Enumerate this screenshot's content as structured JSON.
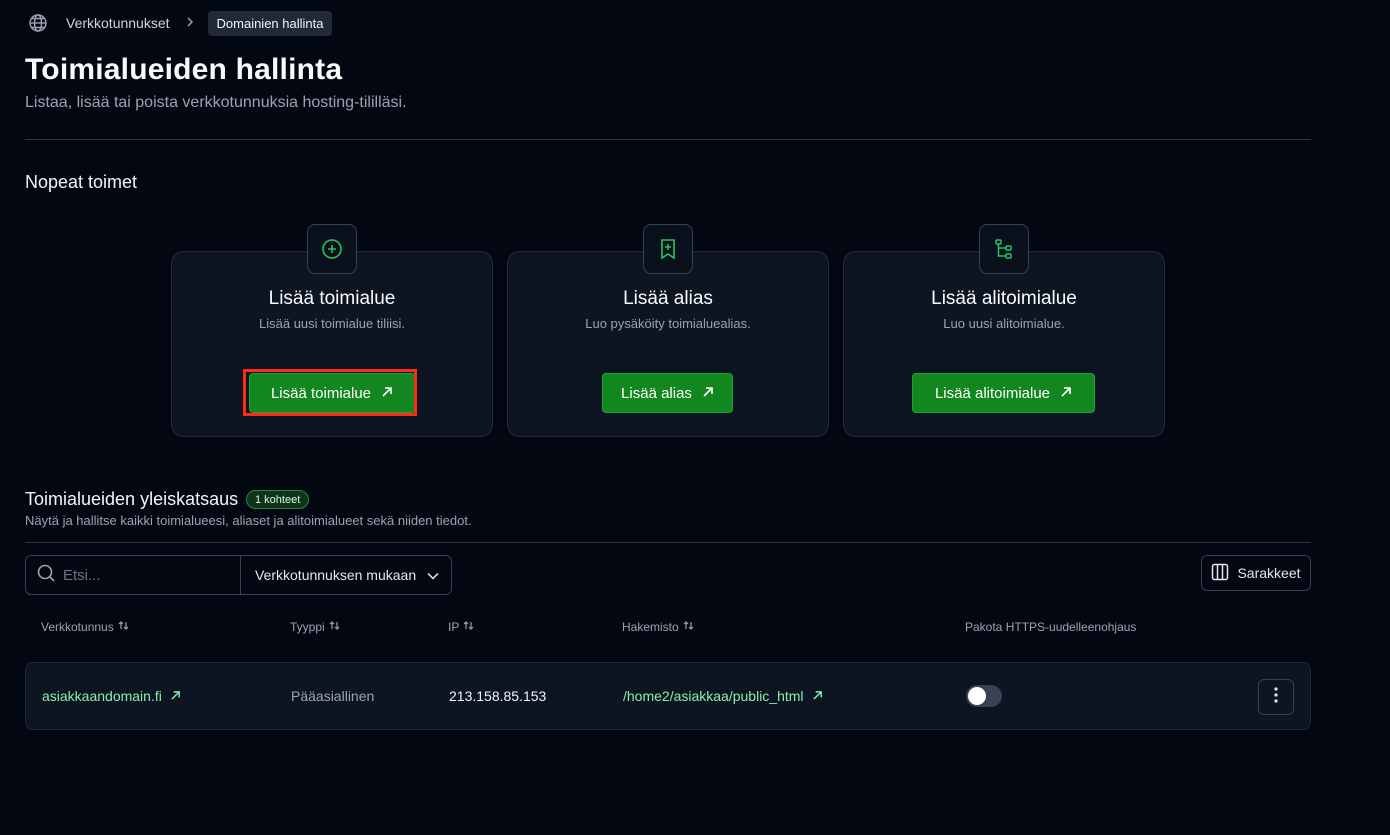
{
  "breadcrumb": {
    "icon": "globe-icon",
    "parent": "Verkkotunnukset",
    "current": "Domainien hallinta"
  },
  "page": {
    "title": "Toimialueiden hallinta",
    "subtitle": "Listaa, lisää tai poista verkkotunnuksia hosting-tililläsi."
  },
  "quick_actions": {
    "title": "Nopeat toimet",
    "cards": [
      {
        "icon": "plus-circle-icon",
        "title": "Lisää toimialue",
        "description": "Lisää uusi toimialue tiliisi.",
        "button": "Lisää toimialue",
        "highlighted": true
      },
      {
        "icon": "bookmark-plus-icon",
        "title": "Lisää alias",
        "description": "Luo pysäköity toimialuealias.",
        "button": "Lisää alias"
      },
      {
        "icon": "folder-tree-icon",
        "title": "Lisää alitoimialue",
        "description": "Luo uusi alitoimialue.",
        "button": "Lisää alitoimialue"
      }
    ]
  },
  "overview": {
    "title": "Toimialueiden yleiskatsaus",
    "badge": "1 kohteet",
    "description": "Näytä ja hallitse kaikki toimialueesi, aliaset ja alitoimialueet sekä niiden tiedot.",
    "search_placeholder": "Etsi...",
    "filter_value": "Verkkotunnuksen mukaan",
    "columns_button": "Sarakkeet",
    "columns": [
      "Verkkotunnus",
      "Tyyppi",
      "IP",
      "Hakemisto",
      "Pakota HTTPS-uudelleenohjaus"
    ],
    "rows": [
      {
        "domain": "asiakkaandomain.fi",
        "type": "Pääasiallinen",
        "ip": "213.158.85.153",
        "directory": "/home2/asiakkaa/public_html",
        "force_https": false
      }
    ]
  },
  "colors": {
    "background": "#030712",
    "card": "#0e1522",
    "accent_green": "#12861f",
    "link_green": "#86efac",
    "highlight_red": "#ff2a17"
  }
}
